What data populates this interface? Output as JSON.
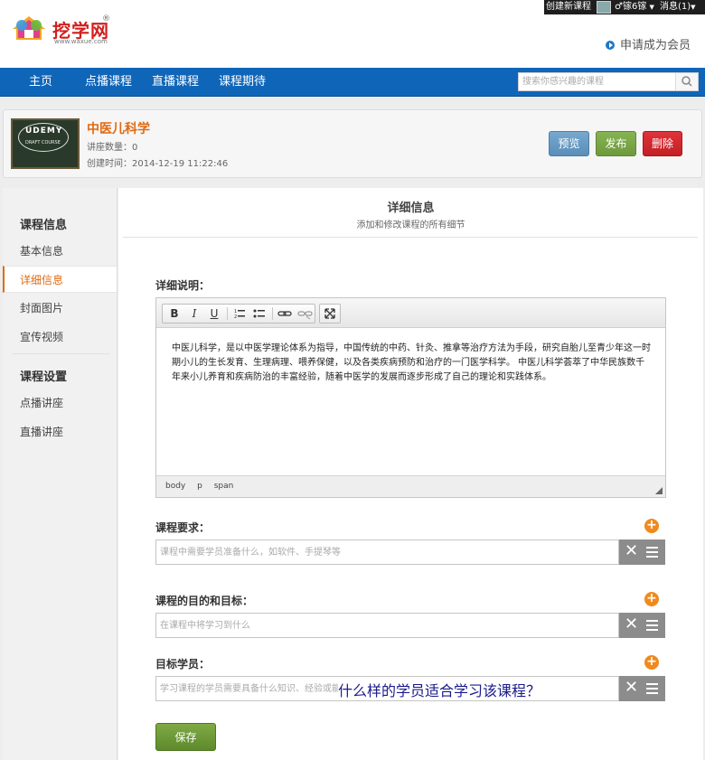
{
  "topbar": {
    "create_course": "创建新课程",
    "user_name": "镓6镓",
    "messages": "消息(1)"
  },
  "header": {
    "logo_text": "挖学网",
    "logo_reg": "®",
    "logo_url": "www.waxue.com",
    "member_link": "申请成为会员"
  },
  "nav": {
    "items": [
      "主页",
      "点播课程",
      "直播课程",
      "课程期待"
    ],
    "search_placeholder": "搜索你感兴趣的课程"
  },
  "course": {
    "thumb_title": "UDEMY",
    "thumb_sub": "DRAFT COURSE",
    "title": "中医儿科学",
    "lecture_count": "讲座数量：0",
    "created": "创建时间：2014-12-19 11:22:46",
    "preview_label": "预览",
    "publish_label": "发布",
    "delete_label": "删除"
  },
  "sidebar": {
    "section1": "课程信息",
    "items1": [
      "基本信息",
      "详细信息",
      "封面图片",
      "宣传视频"
    ],
    "section2": "课程设置",
    "items2": [
      "点播讲座",
      "直播讲座"
    ]
  },
  "main": {
    "title": "详细信息",
    "subtitle": "添加和修改课程的所有细节",
    "desc_label": "详细说明：",
    "editor_text": "中医儿科学，是以中医学理论体系为指导，中国传统的中药、针灸、推拿等治疗方法为手段，研究自胎儿至青少年这一时期小儿的生长发育、生理病理、喂养保健，以及各类疾病预防和治疗的一门医学科学。 中医儿科学荟萃了中华民族数千年来小儿养育和疾病防治的丰富经验，随着中医学的发展而逐步形成了自己的理论和实践体系。",
    "status_path": [
      "body",
      "p",
      "span"
    ],
    "req_label": "课程要求：",
    "req_placeholder": "课程中需要学员准备什么，如软件、手提琴等",
    "goal_label": "课程的目的和目标：",
    "goal_placeholder": "在课程中将学习到什么",
    "audience_label": "目标学员：",
    "audience_placeholder": "学习课程的学员需要具备什么知识、经验或能",
    "audience_overlay": "什么样的学员适合学习该课程？",
    "save_label": "保存"
  }
}
